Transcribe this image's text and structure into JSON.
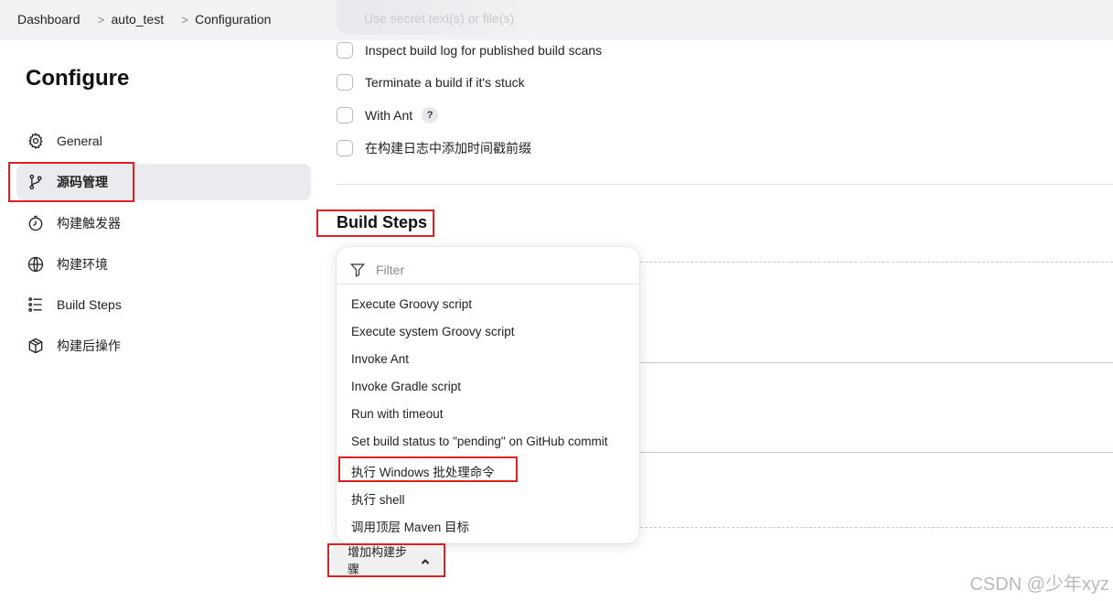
{
  "breadcrumb": [
    "Dashboard",
    "auto_test",
    "Configuration"
  ],
  "ghost_top_text": "Use secret text(s) or file(s)",
  "page_title": "Configure",
  "sidebar": [
    {
      "label": "General",
      "icon": "gear-icon"
    },
    {
      "label": "源码管理",
      "icon": "branch-icon",
      "active": true
    },
    {
      "label": "构建触发器",
      "icon": "timer-icon"
    },
    {
      "label": "构建环境",
      "icon": "globe-icon"
    },
    {
      "label": "Build Steps",
      "icon": "list-icon"
    },
    {
      "label": "构建后操作",
      "icon": "package-icon"
    }
  ],
  "options": [
    {
      "label": "Inspect build log for published build scans",
      "checked": false
    },
    {
      "label": "Terminate a build if it's stuck",
      "checked": false
    },
    {
      "label": "With Ant",
      "checked": false,
      "help": "?"
    },
    {
      "label": "在构建日志中添加时间戳前缀",
      "checked": false
    }
  ],
  "build_steps_title": "Build Steps",
  "dropdown": {
    "filter_placeholder": "Filter",
    "items": [
      "Execute Groovy script",
      "Execute system Groovy script",
      "Invoke Ant",
      "Invoke Gradle script",
      "Run with timeout",
      "Set build status to \"pending\" on GitHub commit",
      "执行 Windows 批处理命令",
      "执行 shell",
      "调用顶层 Maven 目标"
    ]
  },
  "add_step_button": "增加构建步骤",
  "watermark": "CSDN @少年xyz",
  "colors": {
    "highlight": "#e02020",
    "active_bg": "#ebebef",
    "topbar_bg": "#f2f2f4"
  }
}
